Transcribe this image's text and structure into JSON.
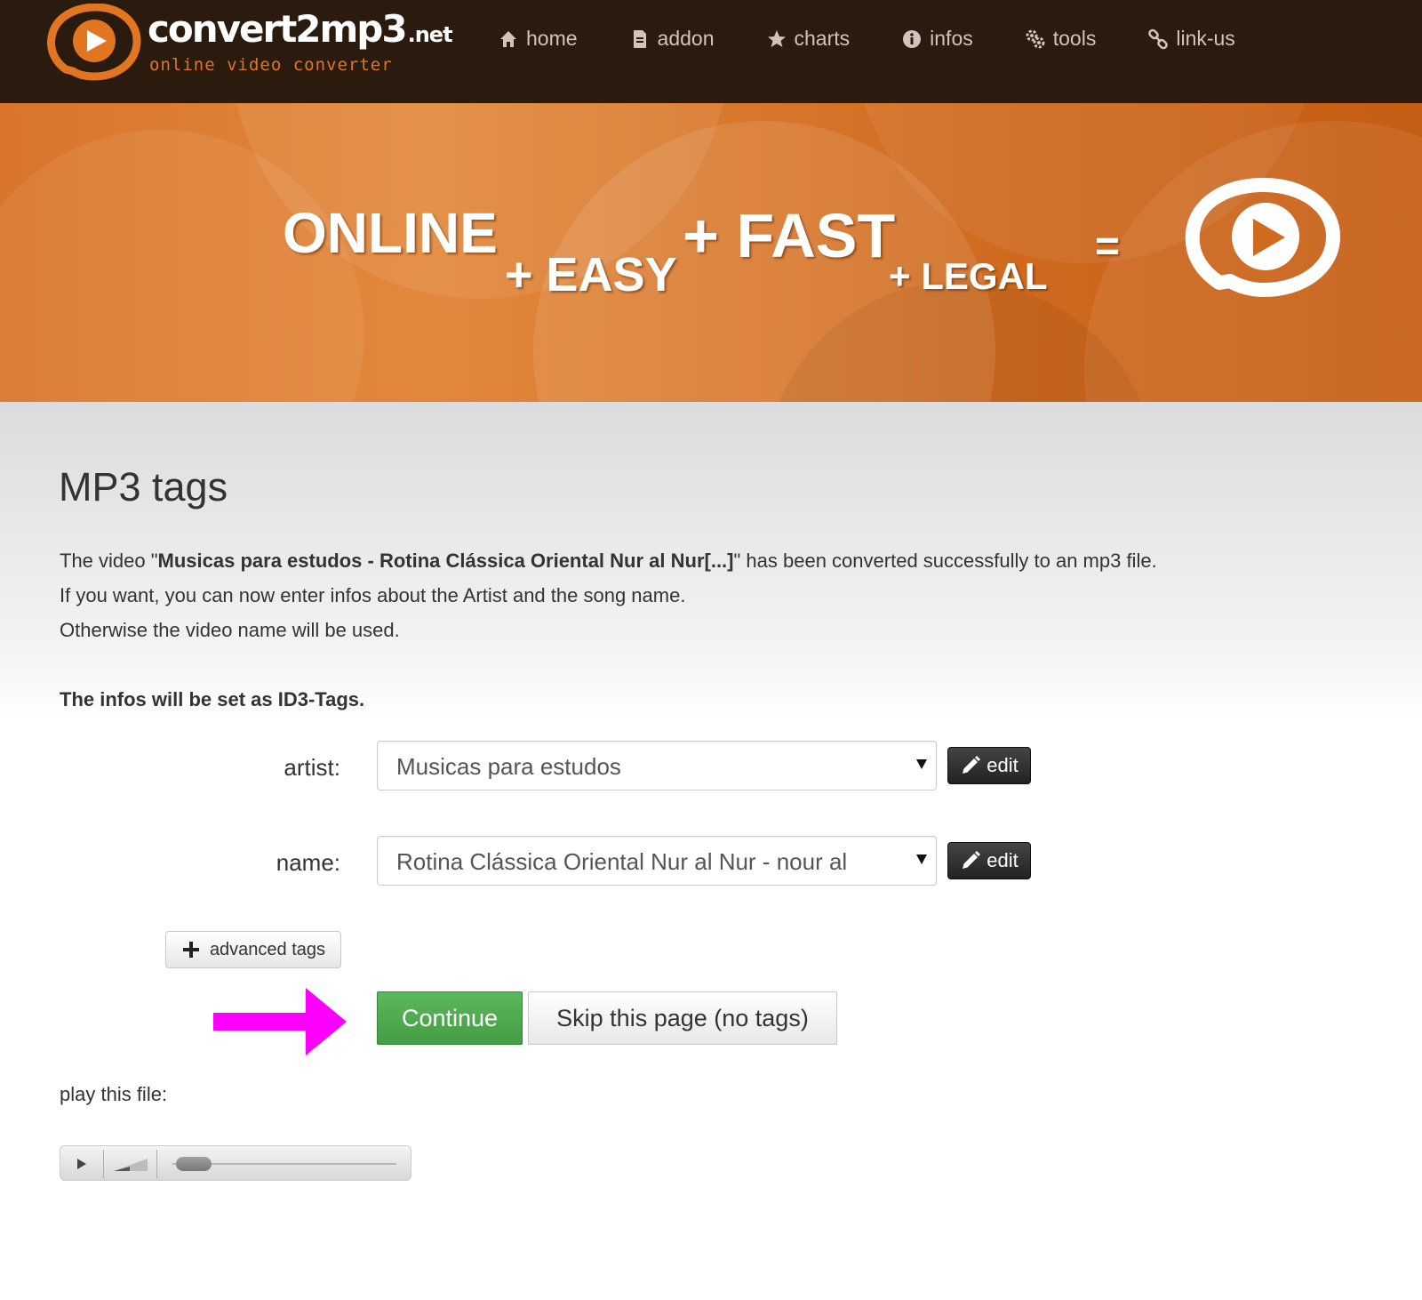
{
  "header": {
    "logo": {
      "name": "convert2mp3",
      "tld": ".net",
      "subtitle": "online video converter"
    },
    "nav": [
      {
        "label": "home",
        "icon": "home-icon"
      },
      {
        "label": "addon",
        "icon": "document-icon"
      },
      {
        "label": "charts",
        "icon": "star-icon"
      },
      {
        "label": "infos",
        "icon": "info-icon"
      },
      {
        "label": "tools",
        "icon": "gears-icon"
      },
      {
        "label": "link-us",
        "icon": "link-icon"
      }
    ]
  },
  "banner": {
    "online": "ONLINE",
    "easy": "+ EASY",
    "fast": "+ FAST",
    "legal": "+ LEGAL",
    "equals": "=",
    "icon": "convert2mp3-play-bubble-icon"
  },
  "main": {
    "title": "MP3 tags",
    "intro_prefix": "The video \"",
    "video_title": "Musicas para estudos - Rotina Clássica Oriental Nur al Nur[...]",
    "intro_suffix": "\" has been converted successfully to an mp3 file.",
    "line2": "If you want, you can now enter infos about the Artist and the song name.",
    "line3": "Otherwise the video name will be used.",
    "note": "The infos will be set as ID3-Tags.",
    "form": {
      "artist_label": "artist:",
      "artist_value": "Musicas para estudos",
      "name_label": "name:",
      "name_value": "Rotina Clássica Oriental Nur al Nur - nour al",
      "edit_label": "edit",
      "advanced_label": "advanced tags"
    },
    "actions": {
      "continue_label": "Continue",
      "skip_label": "Skip this page (no tags)"
    },
    "play_label": "play this file:"
  },
  "colors": {
    "header_bg": "#2b1a0e",
    "brand_orange": "#e27620",
    "continue_green": "#5cb85c",
    "arrow_magenta": "#ff00ff"
  }
}
